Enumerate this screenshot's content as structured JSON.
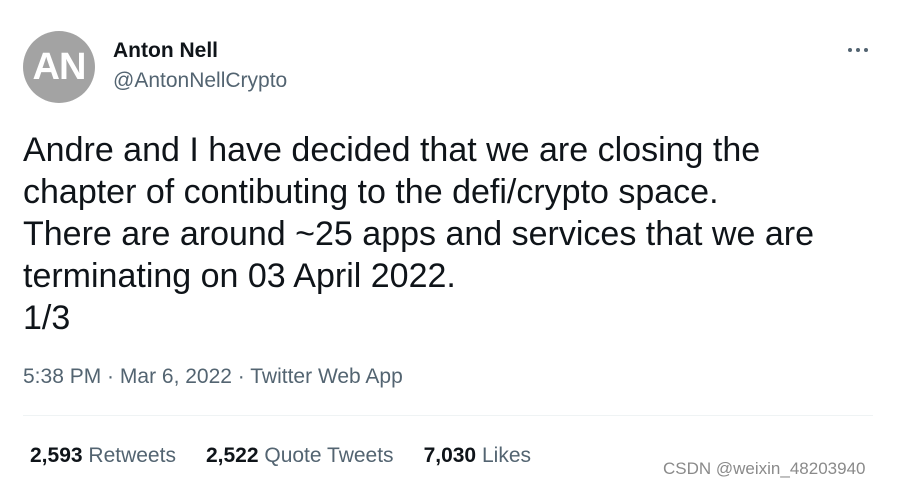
{
  "author": {
    "avatar_initials": "AN",
    "name": "Anton Nell",
    "handle": "@AntonNellCrypto"
  },
  "more_icon": "more-horizontal-icon",
  "tweet": {
    "lines": [
      "Andre and I have decided that we are closing the",
      "chapter of contibuting to the defi/crypto space.",
      "There are around ~25 apps and services that we are",
      "terminating on 03 April 2022.",
      "1/3"
    ]
  },
  "meta": {
    "time": "5:38 PM",
    "separator": " · ",
    "date": "Mar 6, 2022",
    "source": "Twitter Web App"
  },
  "stats": {
    "retweets_count": "2,593",
    "retweets_label": "Retweets",
    "quote_count": "2,522",
    "quote_label": "Quote Tweets",
    "likes_count": "7,030",
    "likes_label": "Likes"
  },
  "watermark": "CSDN @weixin_48203940",
  "colors": {
    "primary_text": "#0f1419",
    "secondary_text": "#536471",
    "avatar_bg": "#a3a3a3",
    "divider": "#eff3f4"
  }
}
